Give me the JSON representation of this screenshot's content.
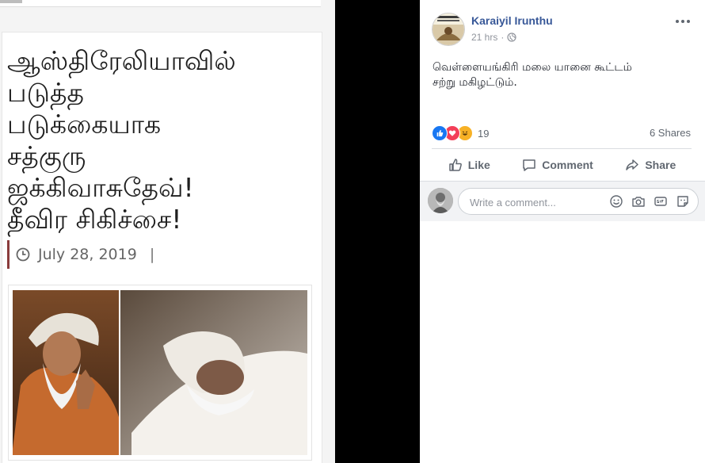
{
  "article": {
    "headline_lines": [
      "ஆஸ்திரேலியாவில்",
      "படுத்த",
      "படுக்கையாக",
      "சத்குரு",
      "ஜக்கிவாசுதேவ்!",
      "தீவிர சிகிச்சை!"
    ],
    "date": "July 28, 2019",
    "separator": "|",
    "accent_color": "#8a3b3b"
  },
  "post": {
    "author": "Karaiyil Irunthu",
    "time": "21 hrs",
    "meta_dot": "·",
    "more_icon": "more-horizontal-icon",
    "text_line1": "வெள்ளையங்கிரி மலை யானை கூட்டம்",
    "text_line2": "சற்று மகிழட்டும்.",
    "reaction_count": "19",
    "shares": "6 Shares",
    "actions": {
      "like": "Like",
      "comment": "Comment",
      "share": "Share"
    },
    "comment_placeholder": "Write a comment...",
    "link_color": "#385898"
  }
}
